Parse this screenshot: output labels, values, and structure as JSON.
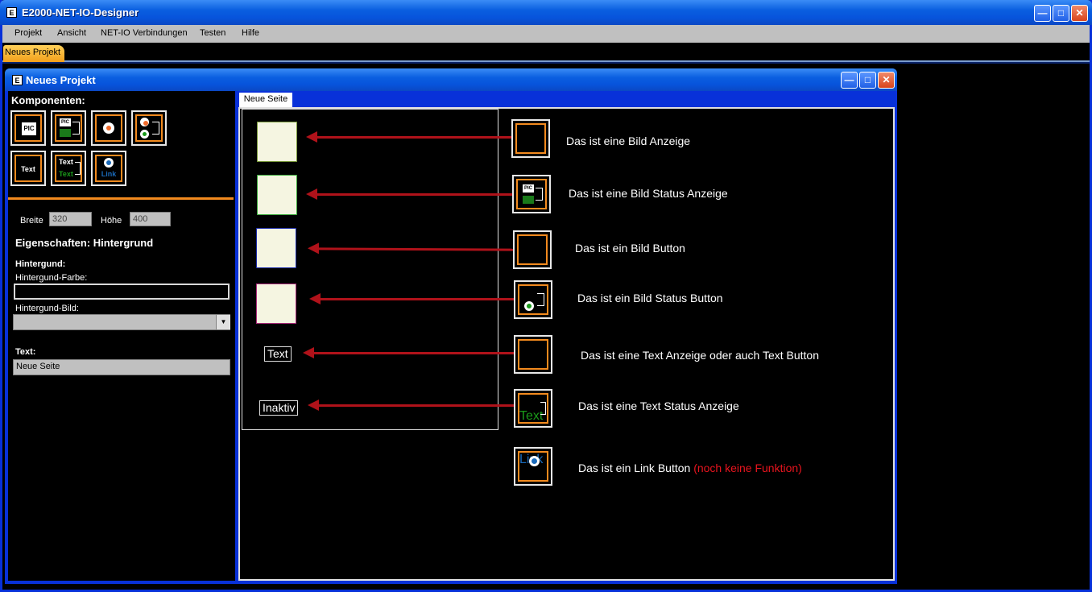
{
  "app": {
    "title": "E2000-NET-IO-Designer",
    "icon_label": "E"
  },
  "menu": {
    "items": [
      "Projekt",
      "Ansicht",
      "NET-IO Verbindungen",
      "Testen",
      "Hilfe"
    ]
  },
  "doc_tab": {
    "label": "Neues Projekt"
  },
  "mdi": {
    "title": "Neues Projekt"
  },
  "left": {
    "komponenten_label": "Komponenten:",
    "icons": {
      "pic": "PIC",
      "text": "Text",
      "link": "Link"
    },
    "breite_label": "Breite",
    "breite_value": "320",
    "hoehe_label": "Höhe",
    "hoehe_value": "400",
    "eigenschaften": "Eigenschaften: Hintergrund",
    "hintergrund_heading": "Hintergund:",
    "farbe_label": "Hintergund-Farbe:",
    "farbe_value": "",
    "bild_label": "Hintergund-Bild:",
    "bild_value": "",
    "text_heading": "Text:",
    "text_value": "Neue Seite"
  },
  "canvas": {
    "tab_label": "Neue Seite",
    "preview_text": "Text",
    "preview_inaktiv": "Inaktiv"
  },
  "descriptions": {
    "bild_anzeige": "Das ist eine Bild Anzeige",
    "bild_status_anzeige": "Das ist eine Bild Status Anzeige",
    "bild_button": "Das ist ein Bild Button",
    "bild_status_button": "Das ist ein Bild Status Button",
    "text_anzeige": "Das ist eine Text Anzeige oder auch Text Button",
    "text_status": "Das ist eine Text Status Anzeige",
    "link_button": "Das ist ein Link Button",
    "link_note": "(noch keine Funktion)"
  },
  "colors": {
    "accent": "#f28a1e",
    "arrow": "#b0121a",
    "note": "#e8141e",
    "titlebar": "#0a5fe0"
  }
}
